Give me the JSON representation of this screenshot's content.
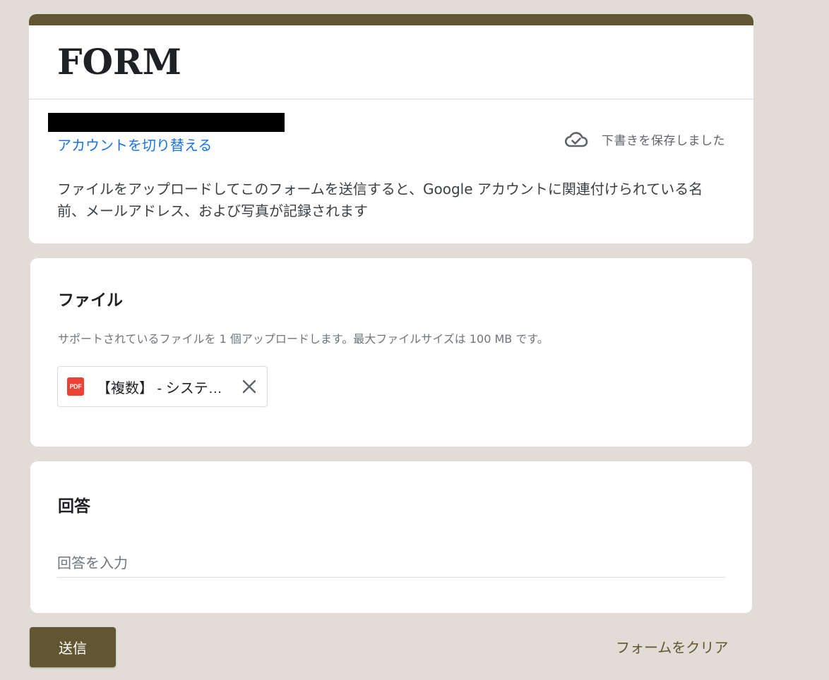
{
  "theme": {
    "accent": "#615631",
    "link": "#1a73e8",
    "clear_text": "#615631"
  },
  "header": {
    "title": "FORM",
    "switch_account_label": "アカウントを切り替える",
    "draft_status": "下書きを保存しました",
    "draft_icon": "cloud-done-icon",
    "disclaimer": "ファイルをアップロードしてこのフォームを送信すると、Google アカウントに関連付けられている名前、メールアドレス、および写真が記録されます"
  },
  "file_question": {
    "title": "ファイル",
    "description": "サポートされているファイルを 1 個アップロードします。最大ファイルサイズは 100 MB です。",
    "file": {
      "type_badge": "PDF",
      "name": "【複数】 - システ…"
    }
  },
  "answer_question": {
    "title": "回答",
    "placeholder": "回答を入力",
    "value": ""
  },
  "actions": {
    "submit_label": "送信",
    "clear_label": "フォームをクリア"
  }
}
